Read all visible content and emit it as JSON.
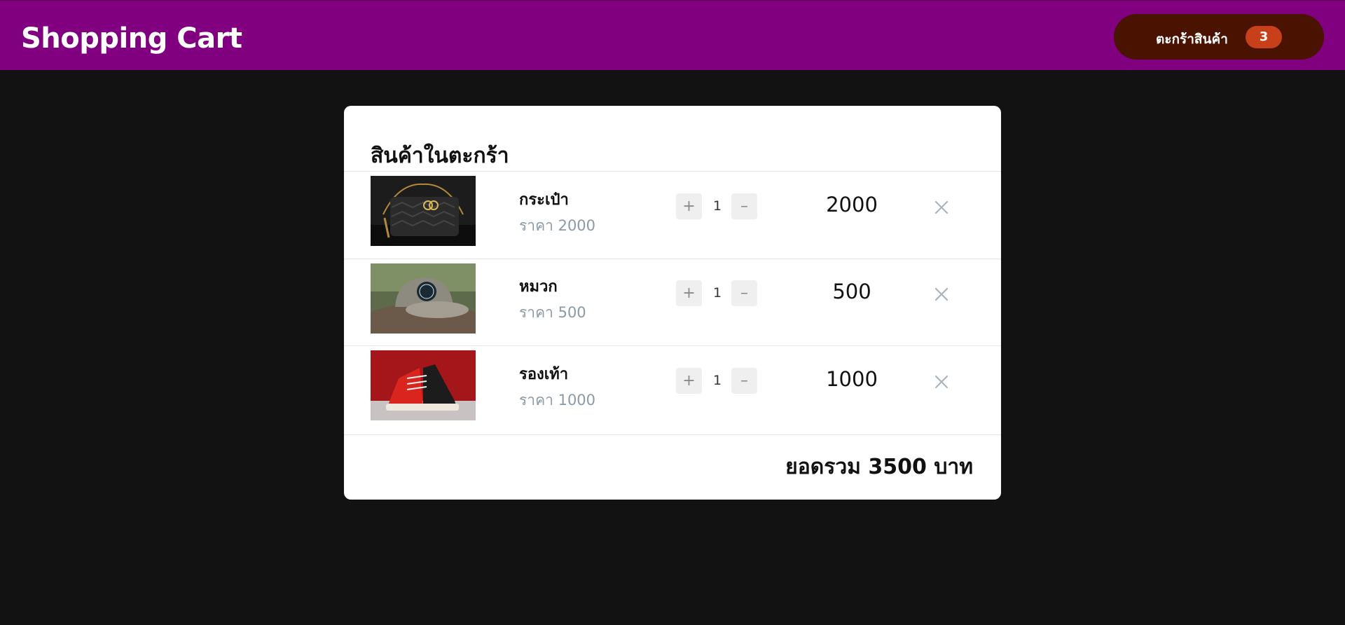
{
  "header": {
    "title": "Shopping Cart",
    "cart_button_label": "ตะกร้าสินค้า",
    "cart_count": "3"
  },
  "cart": {
    "heading": "สินค้าในตะกร้า",
    "items": [
      {
        "name": "กระเป๋า",
        "price_text": "ราคา 2000",
        "quantity": "1",
        "line_total": "2000",
        "image": "handbag-photo"
      },
      {
        "name": "หมวก",
        "price_text": "ราคา 500",
        "quantity": "1",
        "line_total": "500",
        "image": "cap-photo"
      },
      {
        "name": "รองเท้า",
        "price_text": "ราคา 1000",
        "quantity": "1",
        "line_total": "1000",
        "image": "sneaker-photo"
      }
    ],
    "plus_label": "+",
    "minus_label": "–",
    "total_text": "ยอดรวม 3500 บาท"
  },
  "colors": {
    "header_bg": "#800080",
    "cart_button_bg": "#4a1200",
    "badge_bg": "#c7401a",
    "page_bg": "#121212"
  }
}
